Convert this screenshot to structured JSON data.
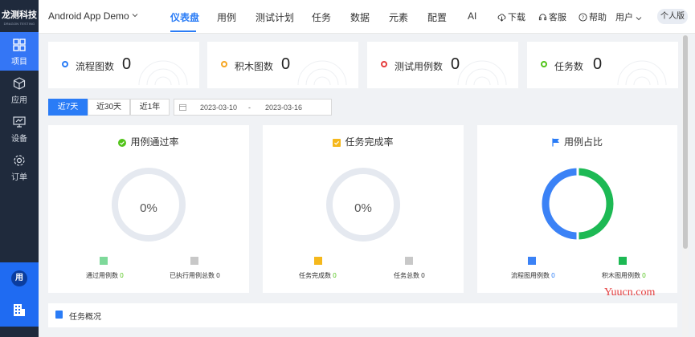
{
  "brand": {
    "title": "龙测科技",
    "subtitle": "DRAGON TESTING"
  },
  "sidebar": {
    "items": [
      {
        "label": "项目",
        "icon": "grid-icon",
        "active": true
      },
      {
        "label": "应用",
        "icon": "cube-icon",
        "active": false
      },
      {
        "label": "设备",
        "icon": "monitor-icon",
        "active": false
      },
      {
        "label": "订单",
        "icon": "gear-icon",
        "active": false
      }
    ],
    "user_avatar": "用"
  },
  "topbar": {
    "project": "Android App Demo",
    "nav": [
      "仪表盘",
      "用例",
      "测试计划",
      "任务",
      "数据",
      "元素",
      "配置",
      "AI"
    ],
    "active_nav": "仪表盘",
    "tools": {
      "download": "下载",
      "service": "客服",
      "help": "帮助",
      "user": "用户"
    },
    "personal": "个人版"
  },
  "stats": [
    {
      "label": "流程图数",
      "value": "0",
      "color": "#2a7cf6"
    },
    {
      "label": "积木图数",
      "value": "0",
      "color": "#f5a623"
    },
    {
      "label": "测试用例数",
      "value": "0",
      "color": "#e53e3e"
    },
    {
      "label": "任务数",
      "value": "0",
      "color": "#52c41a"
    }
  ],
  "range": {
    "buttons": [
      "近7天",
      "近30天",
      "近1年"
    ],
    "active": "近7天",
    "start": "2023-03-10",
    "separator": "-",
    "end": "2023-03-16"
  },
  "panels": {
    "pass_rate": {
      "title": "用例通过率",
      "percent": "0%",
      "legend": [
        {
          "label": "通过用例数",
          "value": "0",
          "color": "#7ed99a"
        },
        {
          "label": "已执行用例总数",
          "value": "0",
          "color": "#c8c8c8"
        }
      ]
    },
    "task_rate": {
      "title": "任务完成率",
      "percent": "0%",
      "legend": [
        {
          "label": "任务完成数",
          "value": "0",
          "color": "#f5b81c"
        },
        {
          "label": "任务总数",
          "value": "0",
          "color": "#c8c8c8"
        }
      ]
    },
    "case_ratio": {
      "title": "用例占比",
      "legend": [
        {
          "label": "流程图用例数",
          "value": "0",
          "color": "#3b82f6"
        },
        {
          "label": "积木图用例数",
          "value": "0",
          "color": "#1db954"
        }
      ],
      "chart_data": {
        "type": "pie",
        "categories": [
          "流程图用例数",
          "积木图用例数"
        ],
        "values": [
          0,
          0
        ],
        "colors": [
          "#3b82f6",
          "#1db954"
        ]
      }
    }
  },
  "overview": {
    "title": "任务概况"
  },
  "watermark": "Yuucn.com"
}
